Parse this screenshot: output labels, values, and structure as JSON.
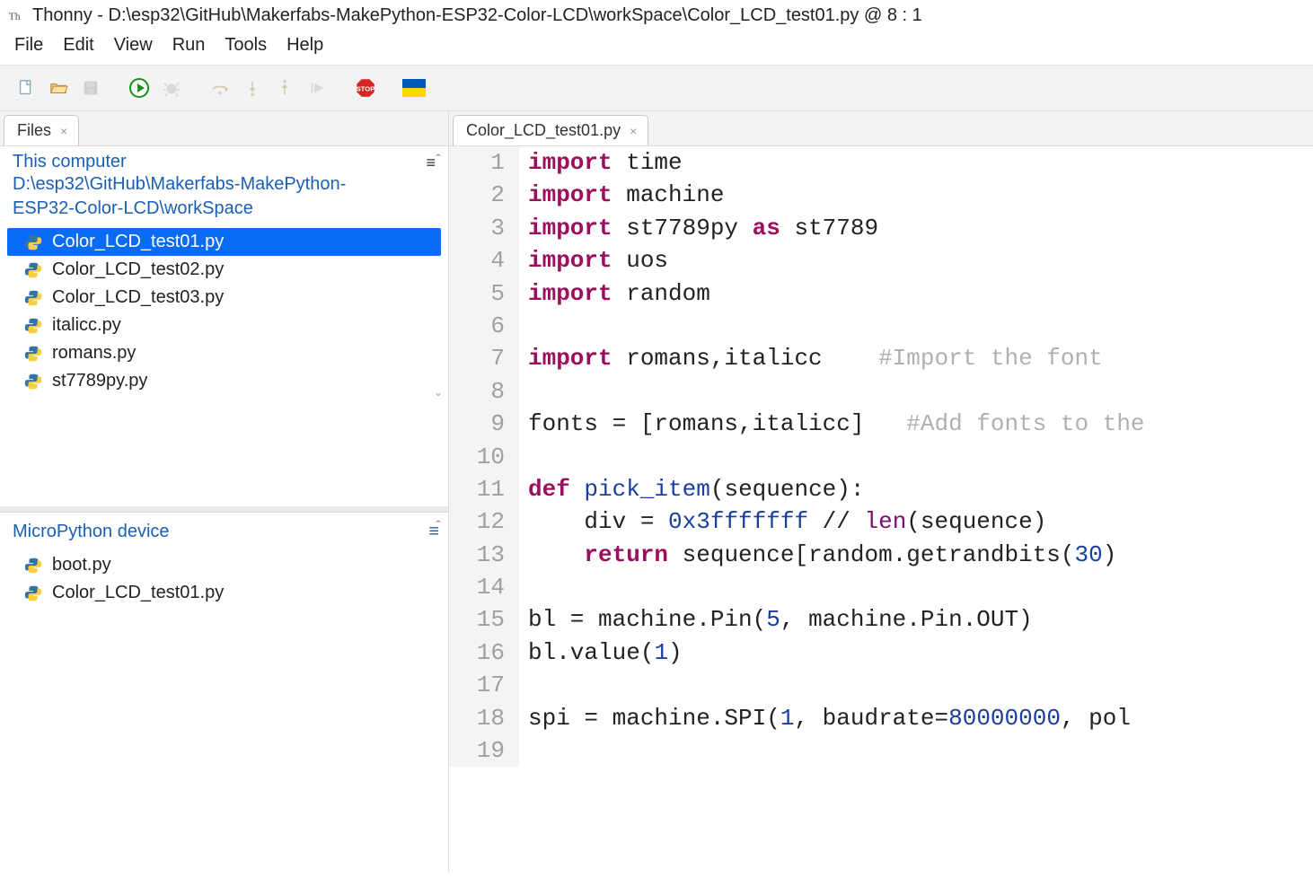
{
  "title": {
    "app": "Thonny",
    "sep": "  -  ",
    "file": "D:\\esp32\\GitHub\\Makerfabs-MakePython-ESP32-Color-LCD\\workSpace\\Color_LCD_test01.py",
    "cursor": "  @  8 : 1"
  },
  "menu": [
    "File",
    "Edit",
    "View",
    "Run",
    "Tools",
    "Help"
  ],
  "toolbar_icons": [
    "new-file-icon",
    "open-file-icon",
    "save-icon",
    "sep",
    "run-icon",
    "debug-icon",
    "sep",
    "step-over-icon",
    "step-into-icon",
    "step-out-icon",
    "resume-icon",
    "sep",
    "stop-icon",
    "sep",
    "flag-ukraine-icon"
  ],
  "filesTab": {
    "label": "Files"
  },
  "filesPanel": {
    "heading": "This computer",
    "path": "D:\\esp32\\GitHub\\Makerfabs-MakePython-ESP32-Color-LCD\\workSpace",
    "items": [
      {
        "name": "Color_LCD_test01.py",
        "selected": true
      },
      {
        "name": "Color_LCD_test02.py",
        "selected": false
      },
      {
        "name": "Color_LCD_test03.py",
        "selected": false
      },
      {
        "name": "italicc.py",
        "selected": false
      },
      {
        "name": "romans.py",
        "selected": false
      },
      {
        "name": "st7789py.py",
        "selected": false
      }
    ]
  },
  "devicePanel": {
    "heading": "MicroPython device",
    "items": [
      {
        "name": "boot.py"
      },
      {
        "name": "Color_LCD_test01.py"
      }
    ]
  },
  "editorTab": {
    "label": "Color_LCD_test01.py"
  },
  "code": {
    "lines": [
      [
        {
          "t": "import ",
          "c": "kw"
        },
        {
          "t": "time"
        }
      ],
      [
        {
          "t": "import ",
          "c": "kw"
        },
        {
          "t": "machine"
        }
      ],
      [
        {
          "t": "import ",
          "c": "kw"
        },
        {
          "t": "st7789py "
        },
        {
          "t": "as ",
          "c": "kw"
        },
        {
          "t": "st7789"
        }
      ],
      [
        {
          "t": "import ",
          "c": "kw"
        },
        {
          "t": "uos"
        }
      ],
      [
        {
          "t": "import ",
          "c": "kw"
        },
        {
          "t": "random"
        }
      ],
      [],
      [
        {
          "t": "import ",
          "c": "kw"
        },
        {
          "t": "romans,italicc    "
        },
        {
          "t": "#Import the font",
          "c": "cmt"
        }
      ],
      [],
      [
        {
          "t": "fonts = [romans,italicc]   "
        },
        {
          "t": "#Add fonts to the",
          "c": "cmt"
        }
      ],
      [],
      [
        {
          "t": "def ",
          "c": "kw"
        },
        {
          "t": "pick_item",
          "c": "fn"
        },
        {
          "t": "(sequence):"
        }
      ],
      [
        {
          "t": "    div = "
        },
        {
          "t": "0x3fffffff",
          "c": "num"
        },
        {
          "t": " // "
        },
        {
          "t": "len",
          "c": "builtin"
        },
        {
          "t": "(sequence)"
        }
      ],
      [
        {
          "t": "    "
        },
        {
          "t": "return ",
          "c": "kw"
        },
        {
          "t": "sequence[random.getrandbits("
        },
        {
          "t": "30",
          "c": "num"
        },
        {
          "t": ")"
        }
      ],
      [],
      [
        {
          "t": "bl = machine.Pin("
        },
        {
          "t": "5",
          "c": "num"
        },
        {
          "t": ", machine.Pin.OUT)"
        }
      ],
      [
        {
          "t": "bl.value("
        },
        {
          "t": "1",
          "c": "num"
        },
        {
          "t": ")"
        }
      ],
      [],
      [
        {
          "t": "spi = machine.SPI("
        },
        {
          "t": "1",
          "c": "num"
        },
        {
          "t": ", baudrate="
        },
        {
          "t": "80000000",
          "c": "num"
        },
        {
          "t": ", pol"
        }
      ],
      []
    ]
  }
}
